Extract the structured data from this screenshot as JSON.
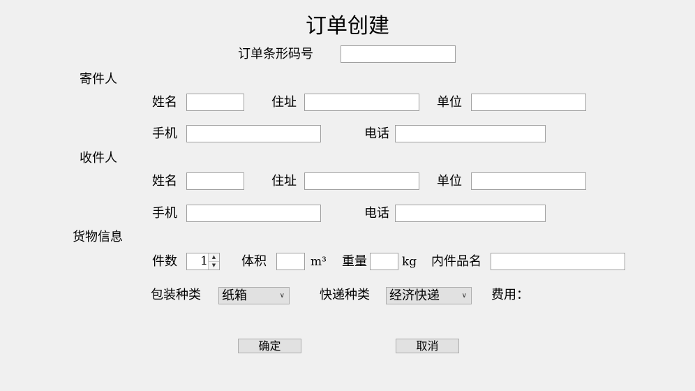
{
  "title": "订单创建",
  "barcode": {
    "label": "订单条形码号",
    "value": ""
  },
  "sender": {
    "section_label": "寄件人",
    "name_label": "姓名",
    "address_label": "住址",
    "company_label": "单位",
    "mobile_label": "手机",
    "phone_label": "电话"
  },
  "receiver": {
    "section_label": "收件人",
    "name_label": "姓名",
    "address_label": "住址",
    "company_label": "单位",
    "mobile_label": "手机",
    "phone_label": "电话"
  },
  "goods": {
    "section_label": "货物信息",
    "count_label": "件数",
    "count_value": "1",
    "volume_label": "体积",
    "volume_unit": "m³",
    "weight_label": "重量",
    "weight_unit": "kg",
    "item_name_label": "内件品名",
    "package_label": "包装种类",
    "package_selected": "纸箱",
    "express_label": "快递种类",
    "express_selected": "经济快递",
    "fee_label": "费用："
  },
  "buttons": {
    "confirm": "确定",
    "cancel": "取消"
  },
  "icons": {
    "spin_up": "▲",
    "spin_down": "▼",
    "dropdown": "∨"
  }
}
